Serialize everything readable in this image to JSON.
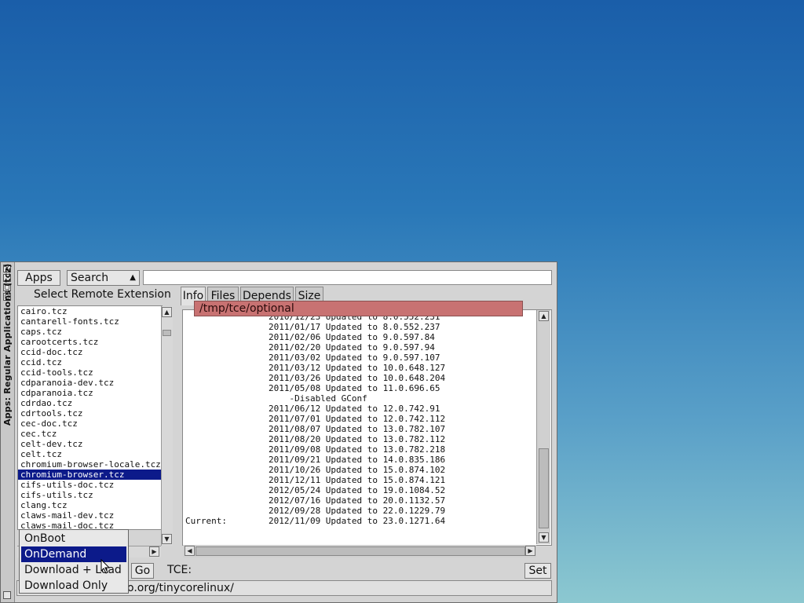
{
  "window": {
    "title": "Apps: Regular Applications (tcz)",
    "close": "x",
    "minimize": "_",
    "maximize": "□",
    "restore": "□"
  },
  "toolbar": {
    "apps_label": "Apps",
    "search_label": "Search",
    "search_value": ""
  },
  "left_pane": {
    "heading": "Select Remote Extension",
    "items": [
      "cairo.tcz",
      "cantarell-fonts.tcz",
      "caps.tcz",
      "carootcerts.tcz",
      "ccid-doc.tcz",
      "ccid.tcz",
      "ccid-tools.tcz",
      "cdparanoia-dev.tcz",
      "cdparanoia.tcz",
      "cdrdao.tcz",
      "cdrtools.tcz",
      "cec-doc.tcz",
      "cec.tcz",
      "celt-dev.tcz",
      "celt.tcz",
      "chromium-browser-locale.tcz",
      "chromium-browser.tcz",
      "cifs-utils-doc.tcz",
      "cifs-utils.tcz",
      "clang.tcz",
      "claws-mail-dev.tcz",
      "claws-mail-doc.tcz"
    ],
    "selected_item": "chromium-browser.tcz"
  },
  "tabs": [
    "Info",
    "Files",
    "Depends",
    "Size"
  ],
  "active_tab": "Info",
  "info_lines": [
    "                2010/12/23 Updated to 8.0.552.231",
    "                2011/01/17 Updated to 8.0.552.237",
    "                2011/02/06 Updated to 9.0.597.84",
    "                2011/02/20 Updated to 9.0.597.94",
    "                2011/03/02 Updated to 9.0.597.107",
    "                2011/03/12 Updated to 10.0.648.127",
    "                2011/03/26 Updated to 10.0.648.204",
    "                2011/05/08 Updated to 11.0.696.65",
    "                    -Disabled GConf",
    "                2011/06/12 Updated to 12.0.742.91",
    "                2011/07/01 Updated to 12.0.742.112",
    "                2011/08/07 Updated to 13.0.782.107",
    "                2011/08/20 Updated to 13.0.782.112",
    "                2011/09/08 Updated to 13.0.782.218",
    "                2011/09/21 Updated to 14.0.835.186",
    "                2011/10/26 Updated to 15.0.874.102",
    "                2011/12/11 Updated to 15.0.874.121",
    "                2012/05/24 Updated to 19.0.1084.52",
    "                2012/07/16 Updated to 20.0.1132.57",
    "                2012/09/28 Updated to 22.0.1229.79",
    "Current:        2012/11/09 Updated to 23.0.1271.64"
  ],
  "bottom": {
    "go_label": "Go",
    "tce_label": "TCE:",
    "tce_path": "/tmp/tce/optional",
    "set_label": "Set",
    "status_text": "o.org/tinycorelinux/"
  },
  "install_mode_menu": {
    "options": [
      "OnBoot",
      "OnDemand",
      "Download + Load",
      "Download Only"
    ],
    "selected": "OnDemand"
  },
  "colors": {
    "selection": "#0c1a8a",
    "tce_field": "#c87272"
  }
}
